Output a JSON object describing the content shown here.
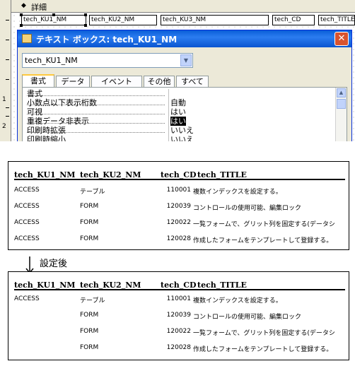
{
  "design": {
    "section_label": "詳細",
    "fields": [
      "tech_KU1_NM",
      "tech_KU2_NM",
      "tech_KU3_NM",
      "tech_CD",
      "tech_TITLE"
    ],
    "ruler_marks": [
      "1",
      "2"
    ]
  },
  "prop_window": {
    "title": "テキスト ボックス: tech_KU1_NM",
    "close_label": "✕",
    "control_select": "tech_KU1_NM",
    "tabs": [
      "書式",
      "データ",
      "イベント",
      "その他",
      "すべて"
    ],
    "active_tab": 0,
    "properties": [
      {
        "name": "書式",
        "value": ""
      },
      {
        "name": "小数点以下表示桁数",
        "value": "自動"
      },
      {
        "name": "可視",
        "value": "はい"
      },
      {
        "name": "重複データ非表示",
        "value": "はい",
        "selected": true
      },
      {
        "name": "印刷時拡張",
        "value": "いいえ"
      },
      {
        "name": "印刷時縮小",
        "value": "いいえ"
      }
    ]
  },
  "tables": {
    "headers": [
      "tech_KU1_NM",
      "tech_KU2_NM",
      "tech_CD",
      "tech_TITLE"
    ],
    "before": [
      [
        "ACCESS",
        "テーブル",
        "110001",
        "複数インデックスを設定する。"
      ],
      [
        "ACCESS",
        "FORM",
        "120039",
        "コントロールの使用可能、編集ロック"
      ],
      [
        "ACCESS",
        "FORM",
        "120022",
        "一覧フォームで、グリット列を固定する(データシ"
      ],
      [
        "ACCESS",
        "FORM",
        "120028",
        "作成したフォームをテンプレートして登録する。"
      ]
    ],
    "after_label": "設定後",
    "after": [
      [
        "ACCESS",
        "テーブル",
        "110001",
        "複数インデックスを設定する。"
      ],
      [
        "",
        "FORM",
        "120039",
        "コントロールの使用可能、編集ロック"
      ],
      [
        "",
        "FORM",
        "120022",
        "一覧フォームで、グリット列を固定する(データシ"
      ],
      [
        "",
        "FORM",
        "120028",
        "作成したフォームをテンプレートして登録する。"
      ]
    ]
  }
}
